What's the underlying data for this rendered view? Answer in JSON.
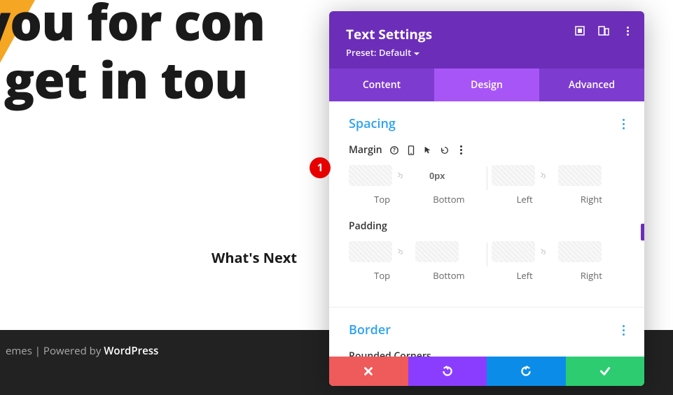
{
  "page": {
    "heading_line1": "nk you for con",
    "heading_line2": "'e'll get in tou",
    "subheading": "What's Next"
  },
  "footer": {
    "themes_text": "emes",
    "separator": " | Powered by ",
    "platform": "WordPress"
  },
  "panel": {
    "title": "Text Settings",
    "preset_label": "Preset: Default",
    "tabs": {
      "content": "Content",
      "design": "Design",
      "advanced": "Advanced"
    },
    "sections": {
      "spacing": {
        "title": "Spacing",
        "margin": {
          "label": "Margin",
          "top": {
            "value": "",
            "label": "Top"
          },
          "bottom": {
            "value": "0px",
            "label": "Bottom"
          },
          "left": {
            "value": "",
            "label": "Left"
          },
          "right": {
            "value": "",
            "label": "Right"
          }
        },
        "padding": {
          "label": "Padding",
          "top": {
            "value": "",
            "label": "Top"
          },
          "bottom": {
            "value": "",
            "label": "Bottom"
          },
          "left": {
            "value": "",
            "label": "Left"
          },
          "right": {
            "value": "",
            "label": "Right"
          }
        }
      },
      "border": {
        "title": "Border",
        "rounded_corners_label": "Rounded Corners"
      }
    }
  },
  "annotation": {
    "number": "1"
  }
}
